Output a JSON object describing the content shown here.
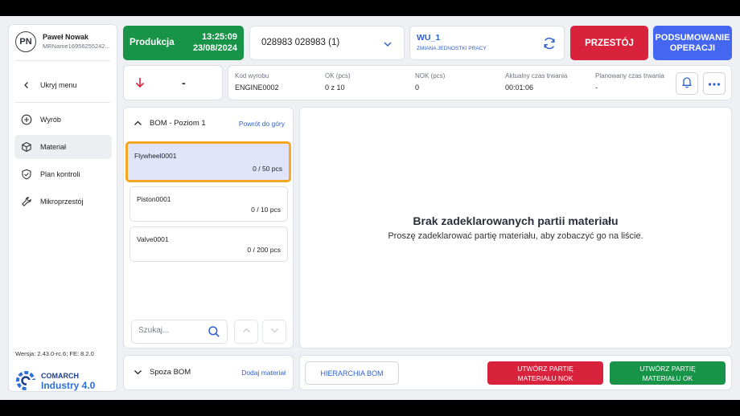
{
  "user": {
    "initials": "PN",
    "name": "Paweł Nowak",
    "id": "MRName16956255242..."
  },
  "sidebar": {
    "hide_menu": "Ukryj menu",
    "items": [
      {
        "label": "Wyrób",
        "icon": "plus-circle-icon",
        "active": false
      },
      {
        "label": "Materiał",
        "icon": "cube-icon",
        "active": true
      },
      {
        "label": "Plan kontroli",
        "icon": "shield-check-icon",
        "active": false
      },
      {
        "label": "Mikroprzestój",
        "icon": "wrench-icon",
        "active": false
      }
    ],
    "version": "Wersja: 2.43.0-rc.6; FE: 8.2.0",
    "brand": {
      "line1": "COMARCH",
      "line2": "Industry 4.0"
    }
  },
  "topbar": {
    "production_label": "Produkcja",
    "time": "13:25:09",
    "date": "23/08/2024",
    "order": "028983 028983 (1)",
    "workunit": "WU_1",
    "workunit_sub": "ZMIANA JEDNOSTKI PRACY",
    "stop_label": "PRZESTÓJ",
    "summary_line1": "PODSUMOWANIE",
    "summary_line2": "OPERACJI"
  },
  "info": {
    "status_value": "-",
    "fields": [
      {
        "key": "Kod wyrobu",
        "value": "ENGINE0002"
      },
      {
        "key": "OK (pcs)",
        "value": "0 z 10"
      },
      {
        "key": "NOK (pcs)",
        "value": "0"
      },
      {
        "key": "Aktualny czas trwania",
        "value": "00:01:06"
      },
      {
        "key": "Planowany czas trwania",
        "value": "-"
      }
    ]
  },
  "bom": {
    "title": "BOM - Poziom 1",
    "back_link": "Powrót do góry",
    "items": [
      {
        "name": "Flywheel0001",
        "qty": "0 / 50 pcs",
        "selected": true
      },
      {
        "name": "Piston0001",
        "qty": "0 / 10 pcs",
        "selected": false
      },
      {
        "name": "Valve0001",
        "qty": "0 / 200 pcs",
        "selected": false
      }
    ],
    "search_placeholder": "Szukaj..."
  },
  "main": {
    "empty_title": "Brak zadeklarowanych partii materiału",
    "empty_subtitle": "Proszę zadeklarować partię materiału, aby zobaczyć go na liście."
  },
  "outside": {
    "title": "Spoza BOM",
    "add_link": "Dodaj materiał"
  },
  "actions": {
    "hierarchy": "HIERARCHIA BOM",
    "nok_line1": "UTWÓRZ PARTIĘ",
    "nok_line2": "MATERIAŁU NOK",
    "ok_line1": "UTWÓRZ PARTIĘ",
    "ok_line2": "MATERIAŁU OK"
  },
  "colors": {
    "green": "#179447",
    "red": "#d9233c",
    "blue": "#4466f0",
    "link": "#2e5fd1",
    "highlight": "#f5a623"
  }
}
